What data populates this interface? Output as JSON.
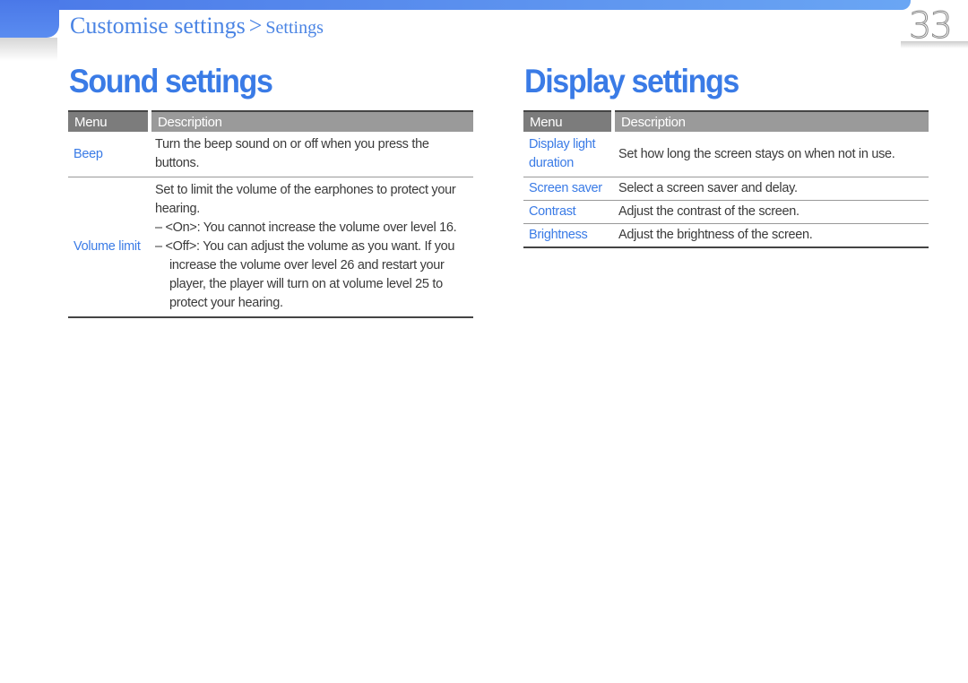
{
  "breadcrumb": {
    "section": "Customise settings",
    "separator": ">",
    "page": "Settings"
  },
  "page_number": "33",
  "sound": {
    "title": "Sound settings",
    "headers": {
      "menu": "Menu",
      "description": "Description"
    },
    "rows": [
      {
        "menu": "Beep",
        "description": "Turn the beep sound on or off when you press the buttons."
      },
      {
        "menu": "Volume limit",
        "description": "Set to limit the volume of the earphones to protect your hearing.",
        "options": [
          "– <On>: You cannot increase the volume over level 16.",
          "– <Off>: You can adjust the volume as you want. If you increase the volume over level 26 and restart your player, the player will turn on at volume level 25 to protect your hearing."
        ]
      }
    ]
  },
  "display": {
    "title": "Display settings",
    "headers": {
      "menu": "Menu",
      "description": "Description"
    },
    "rows": [
      {
        "menu": "Display light duration",
        "description": "Set how long the screen stays on when not in use."
      },
      {
        "menu": "Screen saver",
        "description": "Select a screen saver and delay."
      },
      {
        "menu": "Contrast",
        "description": "Adjust the contrast of the screen."
      },
      {
        "menu": "Brightness",
        "description": "Adjust the brightness of the screen."
      }
    ]
  }
}
